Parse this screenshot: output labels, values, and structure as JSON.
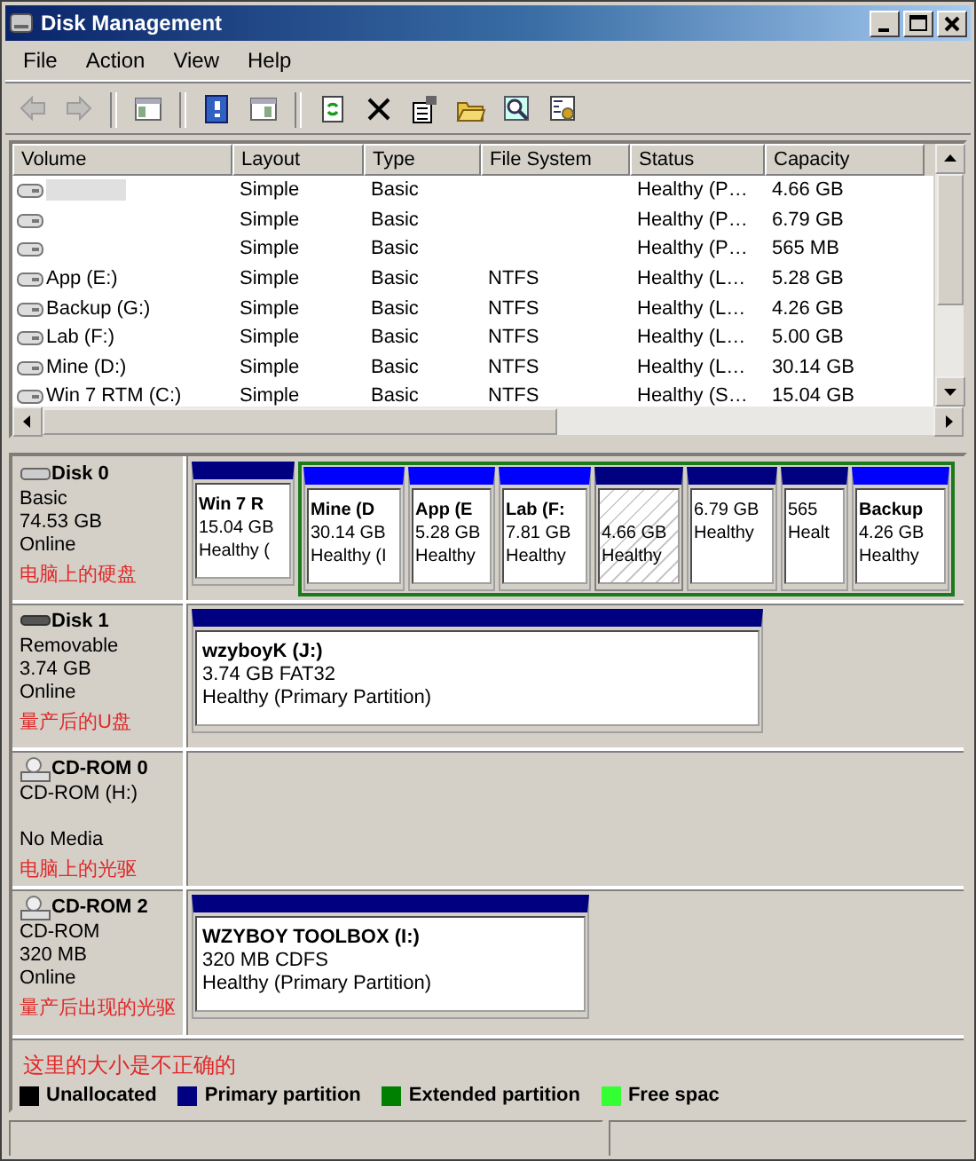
{
  "window": {
    "title": "Disk Management"
  },
  "menu": [
    "File",
    "Action",
    "View",
    "Help"
  ],
  "toolbar": [
    {
      "disabled": true
    },
    {
      "disabled": true
    },
    {
      "disabled": false
    },
    {
      "disabled": false
    },
    {
      "disabled": false
    },
    {
      "disabled": false
    },
    {
      "disabled": false
    },
    {
      "disabled": false
    },
    {
      "disabled": false
    },
    {
      "disabled": false
    },
    {
      "disabled": false
    }
  ],
  "volume_list": {
    "columns": [
      "Volume",
      "Layout",
      "Type",
      "File System",
      "Status",
      "Capacity"
    ],
    "rows": [
      {
        "redacted": true,
        "layout": "Simple",
        "type": "Basic",
        "status": "Healthy (P…",
        "capacity": "4.66 GB"
      },
      {
        "layout": "Simple",
        "type": "Basic",
        "status": "Healthy (P…",
        "capacity": "6.79 GB"
      },
      {
        "layout": "Simple",
        "type": "Basic",
        "status": "Healthy (P…",
        "capacity": "565 MB"
      },
      {
        "volume": "App (E:)",
        "layout": "Simple",
        "type": "Basic",
        "file_system": "NTFS",
        "status": "Healthy (L…",
        "capacity": "5.28 GB"
      },
      {
        "volume": "Backup (G:)",
        "layout": "Simple",
        "type": "Basic",
        "file_system": "NTFS",
        "status": "Healthy (L…",
        "capacity": "4.26 GB"
      },
      {
        "volume": "Lab (F:)",
        "layout": "Simple",
        "type": "Basic",
        "file_system": "NTFS",
        "status": "Healthy (L…",
        "capacity": "5.00 GB"
      },
      {
        "volume": "Mine (D:)",
        "layout": "Simple",
        "type": "Basic",
        "file_system": "NTFS",
        "status": "Healthy (L…",
        "capacity": "30.14 GB"
      },
      {
        "volume": "Win 7 RTM (C:)",
        "layout": "Simple",
        "type": "Basic",
        "file_system": "NTFS",
        "status": "Healthy (S…",
        "capacity": "15.04 GB"
      }
    ]
  },
  "disks": [
    {
      "kind": "disk",
      "name": "Disk 0",
      "info": [
        "Basic",
        "74.53 GB",
        "Online"
      ],
      "annotation": "电脑上的硬盘",
      "partitions": [
        {
          "kind": "primary",
          "selected": false,
          "lines": [
            "Win 7 R",
            "15.04 GB",
            "Healthy ("
          ]
        }
      ],
      "extended": [
        {
          "kind": "logical",
          "selected": false,
          "lines": [
            "Mine (D",
            "30.14 GB",
            "Healthy (I"
          ]
        },
        {
          "kind": "logical",
          "selected": false,
          "lines": [
            "App (E",
            "5.28 GB",
            "Healthy"
          ]
        },
        {
          "kind": "logical",
          "selected": false,
          "lines": [
            "Lab (F:",
            "7.81 GB",
            "Healthy"
          ]
        },
        {
          "kind": "primary",
          "selected": true,
          "lines": [
            "4.66 GB",
            "Healthy"
          ]
        },
        {
          "kind": "primary",
          "selected": false,
          "lines": [
            "6.79 GB",
            "Healthy"
          ]
        },
        {
          "kind": "primary",
          "selected": false,
          "lines": [
            "565",
            "Healt"
          ]
        },
        {
          "kind": "logical",
          "selected": false,
          "lines": [
            "Backup",
            "4.26 GB",
            "Healthy"
          ]
        }
      ]
    },
    {
      "kind": "removable",
      "name": "Disk 1",
      "info": [
        "Removable",
        "3.74 GB",
        "Online"
      ],
      "annotation": "量产后的U盘",
      "partitions": [
        {
          "kind": "primary",
          "selected": false,
          "lines": [
            "wzyboyK  (J:)",
            "3.74 GB FAT32",
            "Healthy (Primary Partition)"
          ]
        }
      ]
    },
    {
      "kind": "cdrom",
      "name": "CD-ROM 0",
      "info": [
        "CD-ROM (H:)",
        "No Media"
      ],
      "annotation": "电脑上的光驱"
    },
    {
      "kind": "cdrom",
      "name": "CD-ROM 2",
      "info": [
        "CD-ROM",
        "320 MB",
        "Online"
      ],
      "annotation": "量产后出现的光驱",
      "partitions": [
        {
          "kind": "primary",
          "selected": false,
          "lines": [
            "WZYBOY TOOLBOX  (I:)",
            "320 MB CDFS",
            "Healthy (Primary Partition)"
          ]
        }
      ]
    }
  ],
  "note": "这里的大小是不正确的",
  "legend": [
    {
      "label": "Unallocated",
      "color": "#000000"
    },
    {
      "label": "Primary partition",
      "color": "#000080"
    },
    {
      "label": "Extended partition",
      "color": "#008000"
    },
    {
      "label": "Free spac",
      "color": "#33ff33"
    }
  ]
}
